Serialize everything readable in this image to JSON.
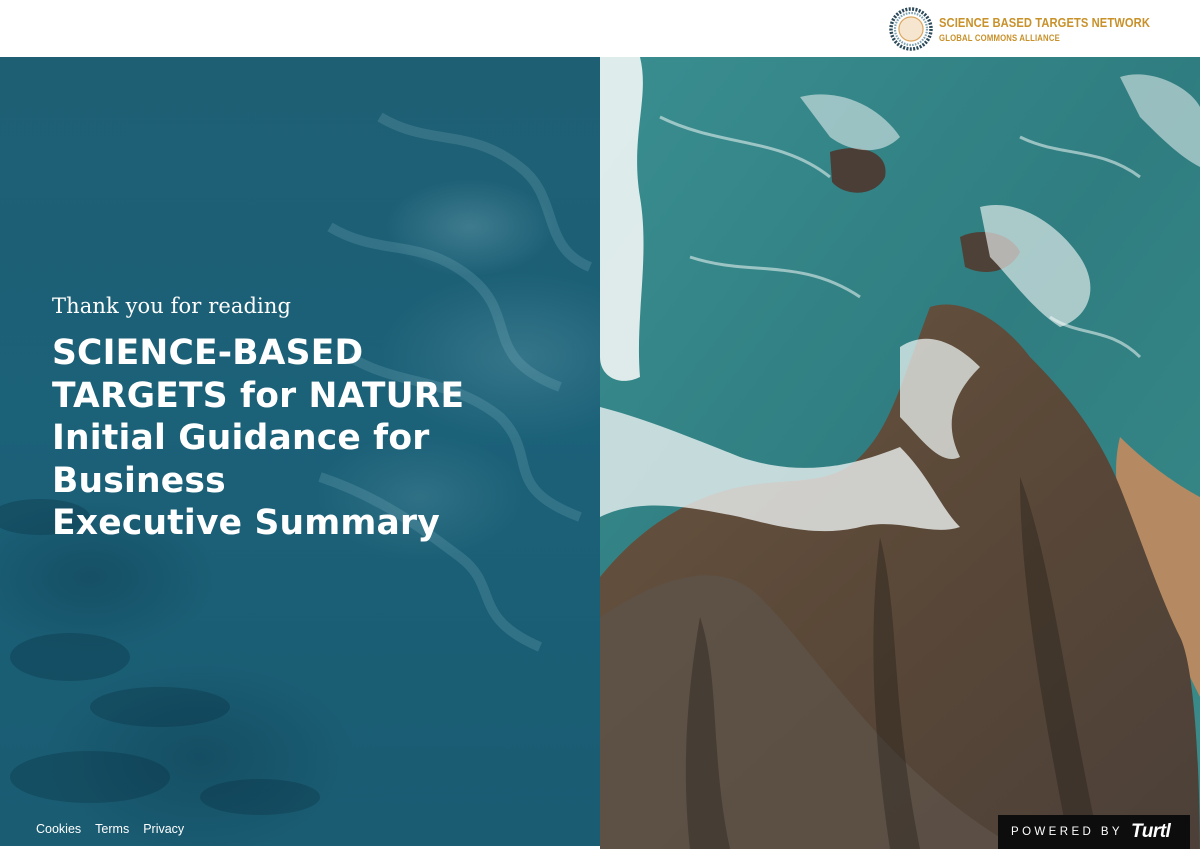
{
  "header": {
    "logo": {
      "title": "SCIENCE BASED TARGETS NETWORK",
      "subtitle": "GLOBAL COMMONS ALLIANCE",
      "icon": "sbtn-ring-logo",
      "accent_color": "#c8912a"
    }
  },
  "hero": {
    "pre_title": "Thank you for reading",
    "title_lines": [
      "SCIENCE-BASED",
      "TARGETS for NATURE",
      "Initial Guidance for",
      "Business",
      "Executive Summary"
    ]
  },
  "footer": {
    "links": [
      "Cookies",
      "Terms",
      "Privacy"
    ]
  },
  "powered_by": {
    "label": "POWERED BY",
    "brand": "Turtl"
  },
  "colors": {
    "ocean_panel": "#1b6178",
    "text": "#ffffff",
    "powered_bg": "#0d0d0d"
  }
}
